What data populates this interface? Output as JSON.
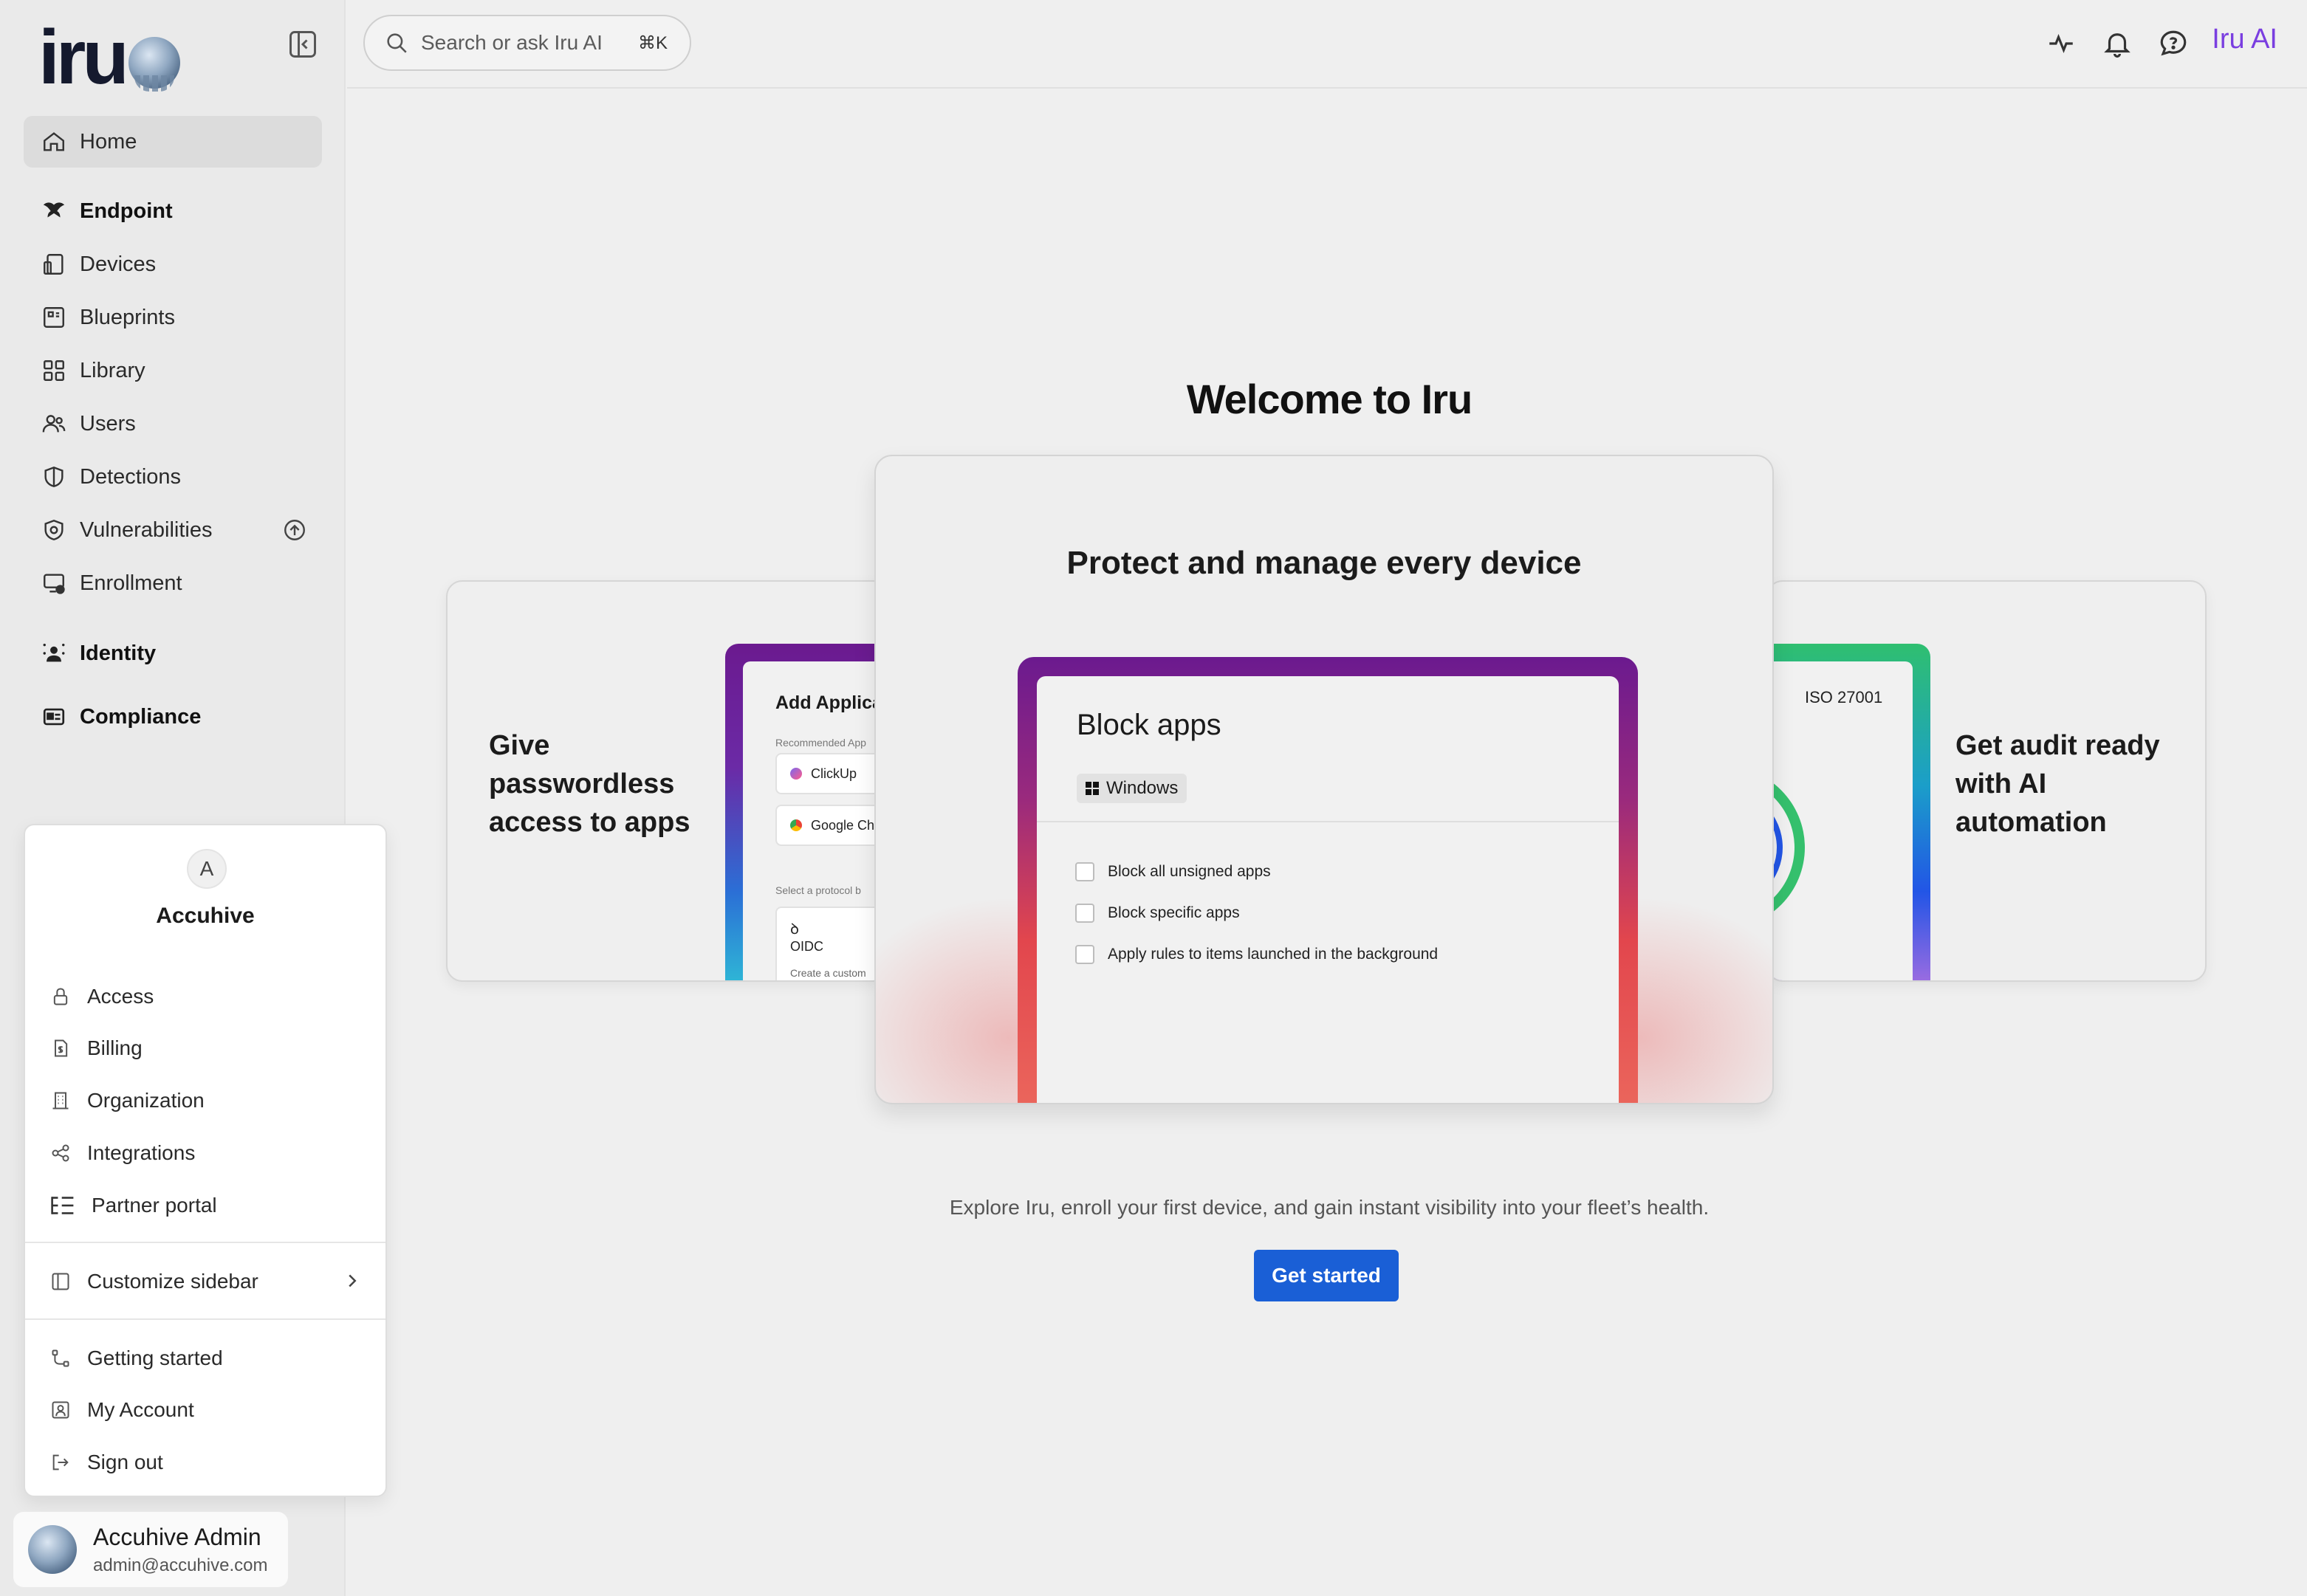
{
  "app": {
    "logo_text": "iru"
  },
  "sidebar": {
    "items": [
      {
        "label": "Home"
      },
      {
        "label": "Endpoint"
      },
      {
        "label": "Devices"
      },
      {
        "label": "Blueprints"
      },
      {
        "label": "Library"
      },
      {
        "label": "Users"
      },
      {
        "label": "Detections"
      },
      {
        "label": "Vulnerabilities"
      },
      {
        "label": "Enrollment"
      },
      {
        "label": "Identity"
      },
      {
        "label": "Compliance"
      }
    ]
  },
  "account_menu": {
    "avatar_letter": "A",
    "org_name": "Accuhive",
    "items": [
      {
        "label": "Access"
      },
      {
        "label": "Billing"
      },
      {
        "label": "Organization"
      },
      {
        "label": "Integrations"
      },
      {
        "label": "Partner portal"
      },
      {
        "label": "Customize sidebar"
      },
      {
        "label": "Getting started"
      },
      {
        "label": "My Account"
      },
      {
        "label": "Sign out"
      }
    ]
  },
  "user": {
    "name": "Accuhive Admin",
    "email": "admin@accuhive.com"
  },
  "topbar": {
    "search_placeholder": "Search or ask Iru AI",
    "search_shortcut": "⌘K",
    "ai_label": "Iru AI"
  },
  "main": {
    "welcome_title": "Welcome to Iru",
    "center_card": {
      "title": "Protect and manage every device",
      "panel_title": "Block apps",
      "platform_chip": "Windows",
      "options": [
        "Block all unsigned apps",
        "Block specific apps",
        "Apply rules to items launched in the background"
      ]
    },
    "left_card": {
      "title": "Give passwordless access to apps",
      "panel_title": "Add Applica",
      "recommended_label": "Recommended App",
      "apps": [
        "ClickUp",
        "Google Ch"
      ],
      "protocol_label": "Select a protocol b",
      "protocol": "OIDC",
      "protocol_desc": "Create a custom"
    },
    "right_card": {
      "title": "Get audit ready with AI automation",
      "badge": "ISO 27001"
    },
    "explore_text": "Explore Iru, enroll your first device, and gain instant visibility into your fleet’s health.",
    "cta_label": "Get started"
  },
  "colors": {
    "accent": "#1a5fd6",
    "ai_purple": "#7a3ee0",
    "frame_top": "#6b1a8f",
    "frame_bottom": "#ec6a5e"
  }
}
